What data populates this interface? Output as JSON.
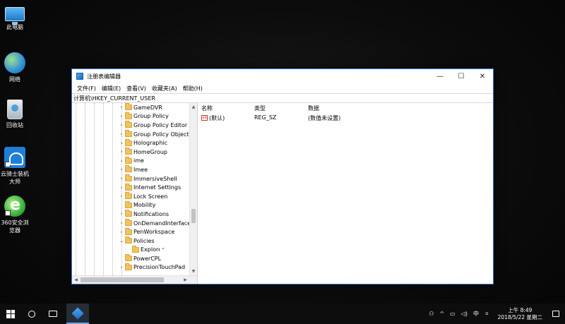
{
  "desktop": {
    "icons": [
      {
        "label": "此电脑",
        "icon": "computer-icon"
      },
      {
        "label": "网络",
        "icon": "network-icon"
      },
      {
        "label": "回收站",
        "icon": "recycle-bin-icon"
      },
      {
        "label": "云骑士装机大师",
        "icon": "yunqishi-icon"
      },
      {
        "label": "360安全浏览器",
        "icon": "360-browser-icon"
      }
    ]
  },
  "window": {
    "title": "注册表编辑器",
    "controls": {
      "minimize": "—",
      "maximize": "☐",
      "close": "✕"
    },
    "menu": [
      "文件(F)",
      "编辑(E)",
      "查看(V)",
      "收藏夹(A)",
      "帮助(H)"
    ],
    "address": "计算机\\HKEY_CURRENT_USER",
    "tree": [
      {
        "label": "GameDVR",
        "expander": "›"
      },
      {
        "label": "Group Policy",
        "expander": "›"
      },
      {
        "label": "Group Policy Editor",
        "expander": "›"
      },
      {
        "label": "Group Policy Objects",
        "expander": "›"
      },
      {
        "label": "Holographic",
        "expander": "›"
      },
      {
        "label": "HomeGroup",
        "expander": "›"
      },
      {
        "label": "ime",
        "expander": "›"
      },
      {
        "label": "Imee",
        "expander": "›"
      },
      {
        "label": "ImmersiveShell",
        "expander": "›"
      },
      {
        "label": "Internet Settings",
        "expander": "›"
      },
      {
        "label": "Lock Screen",
        "expander": "›"
      },
      {
        "label": "Mobility",
        "expander": ""
      },
      {
        "label": "Notifications",
        "expander": "›"
      },
      {
        "label": "OnDemandInterfaceC",
        "expander": "›"
      },
      {
        "label": "PenWorkspace",
        "expander": "›"
      },
      {
        "label": "Policies",
        "expander": "⌄"
      },
      {
        "label": "Explorer",
        "expander": "",
        "child": true
      },
      {
        "label": "PowerCPL",
        "expander": ""
      },
      {
        "label": "PrecisionTouchPad",
        "expander": "›"
      }
    ],
    "columns": {
      "name": "名称",
      "type": "类型",
      "data": "数据"
    },
    "values": [
      {
        "icon": "ab",
        "name": "(默认)",
        "type": "REG_SZ",
        "data": "(数值未设置)"
      }
    ]
  },
  "taskbar": {
    "tray": {
      "ime": "中",
      "time": "上午 8:49",
      "date": "2018/5/22 星期二"
    }
  }
}
